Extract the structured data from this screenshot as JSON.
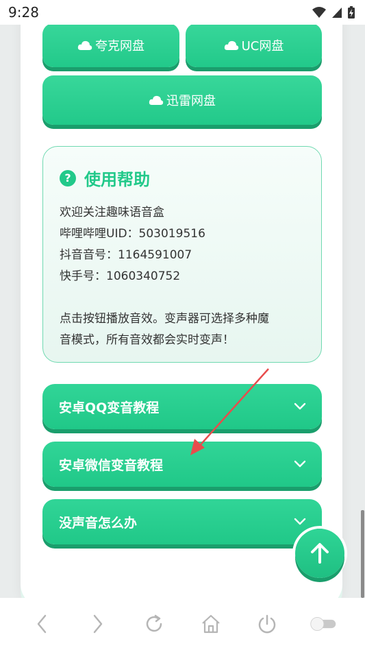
{
  "status_bar": {
    "time": "9:28"
  },
  "buttons": {
    "quark": "夸克网盘",
    "uc": "UC网盘",
    "xunlei": "迅雷网盘"
  },
  "help": {
    "title": "使用帮助",
    "lines": [
      "欢迎关注趣味语音盒",
      "哔哩哔哩UID：503019516",
      "抖音音号：1164591007",
      "快手号：1060340752"
    ],
    "note_line1": "点击按钮播放音效。变声器可选择多种魔",
    "note_line2": "音模式，所有音效都会实时变声！"
  },
  "accordion": [
    {
      "label": "安卓QQ变音教程"
    },
    {
      "label": "安卓微信变音教程"
    },
    {
      "label": "没声音怎么办"
    }
  ],
  "icons": {
    "cloud": "cloud-icon",
    "help": "question-icon",
    "chevron": "chevron-down-icon",
    "back_to_top": "arrow-up-icon"
  },
  "colors": {
    "accent": "#22c98a",
    "accent_dark": "#1a9e6c",
    "annotation": "#e84c4c"
  }
}
